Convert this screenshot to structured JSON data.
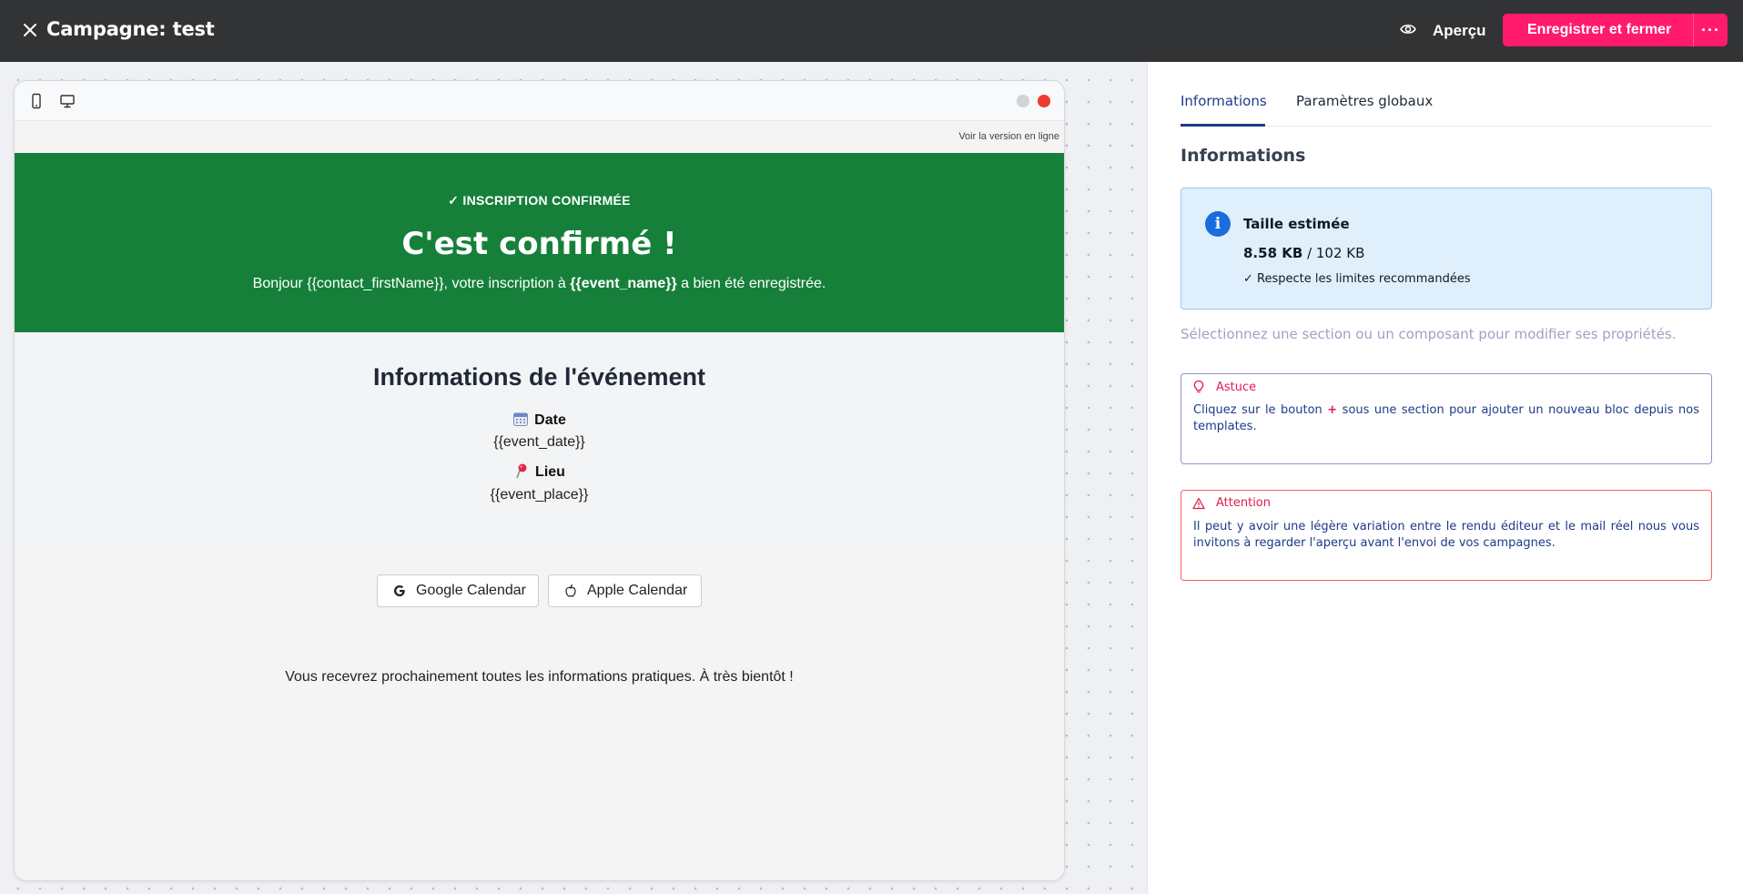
{
  "header": {
    "title": "Campagne: test",
    "preview_label": "Aperçu",
    "save_label": "Enregistrer et fermer",
    "more_label": "···"
  },
  "email": {
    "online_link": "Voir la version en ligne",
    "hero_tag": "✓ INSCRIPTION CONFIRMÉE",
    "hero_title": "C'est confirmé !",
    "hero_sub_before": "Bonjour {{contact_firstName}}, votre inscription à ",
    "hero_sub_bold": "{{event_name}}",
    "hero_sub_after": " a bien été enregistrée.",
    "info_title": "Informations de l'événement",
    "date_label": "Date",
    "date_value": "{{event_date}}",
    "place_label": "Lieu",
    "place_value": "{{event_place}}",
    "google_label": "Google Calendar",
    "apple_label": "Apple Calendar",
    "closing": "Vous recevrez prochainement toutes les informations pratiques. À très bientôt !"
  },
  "panel": {
    "tabs": [
      {
        "label": "Informations",
        "active": true
      },
      {
        "label": "Paramètres globaux",
        "active": false
      }
    ],
    "heading": "Informations",
    "size": {
      "title": "Taille estimée",
      "current": "8.58 KB",
      "limit": " / 102 KB",
      "status": "✓ Respecte les limites recommandées"
    },
    "hint": "Sélectionnez une section ou un composant pour modifier ses propriétés.",
    "tip": {
      "title": "Astuce",
      "text_before": "Cliquez sur le bouton ",
      "plus": "+",
      "text_after": " sous une section pour ajouter un nouveau bloc depuis nos templates."
    },
    "warning": {
      "title": "Attention",
      "text": "Il peut y avoir une légère variation entre le rendu éditeur et le mail réel nous vous invitons à regarder l'aperçu avant l'envoi de vos campagnes."
    }
  },
  "colors": {
    "topbar": "#323335",
    "accent": "#ff1a6c",
    "hero_green": "#16803a",
    "tab_active": "#1e3a8a",
    "info_blue": "#1b6dde"
  }
}
